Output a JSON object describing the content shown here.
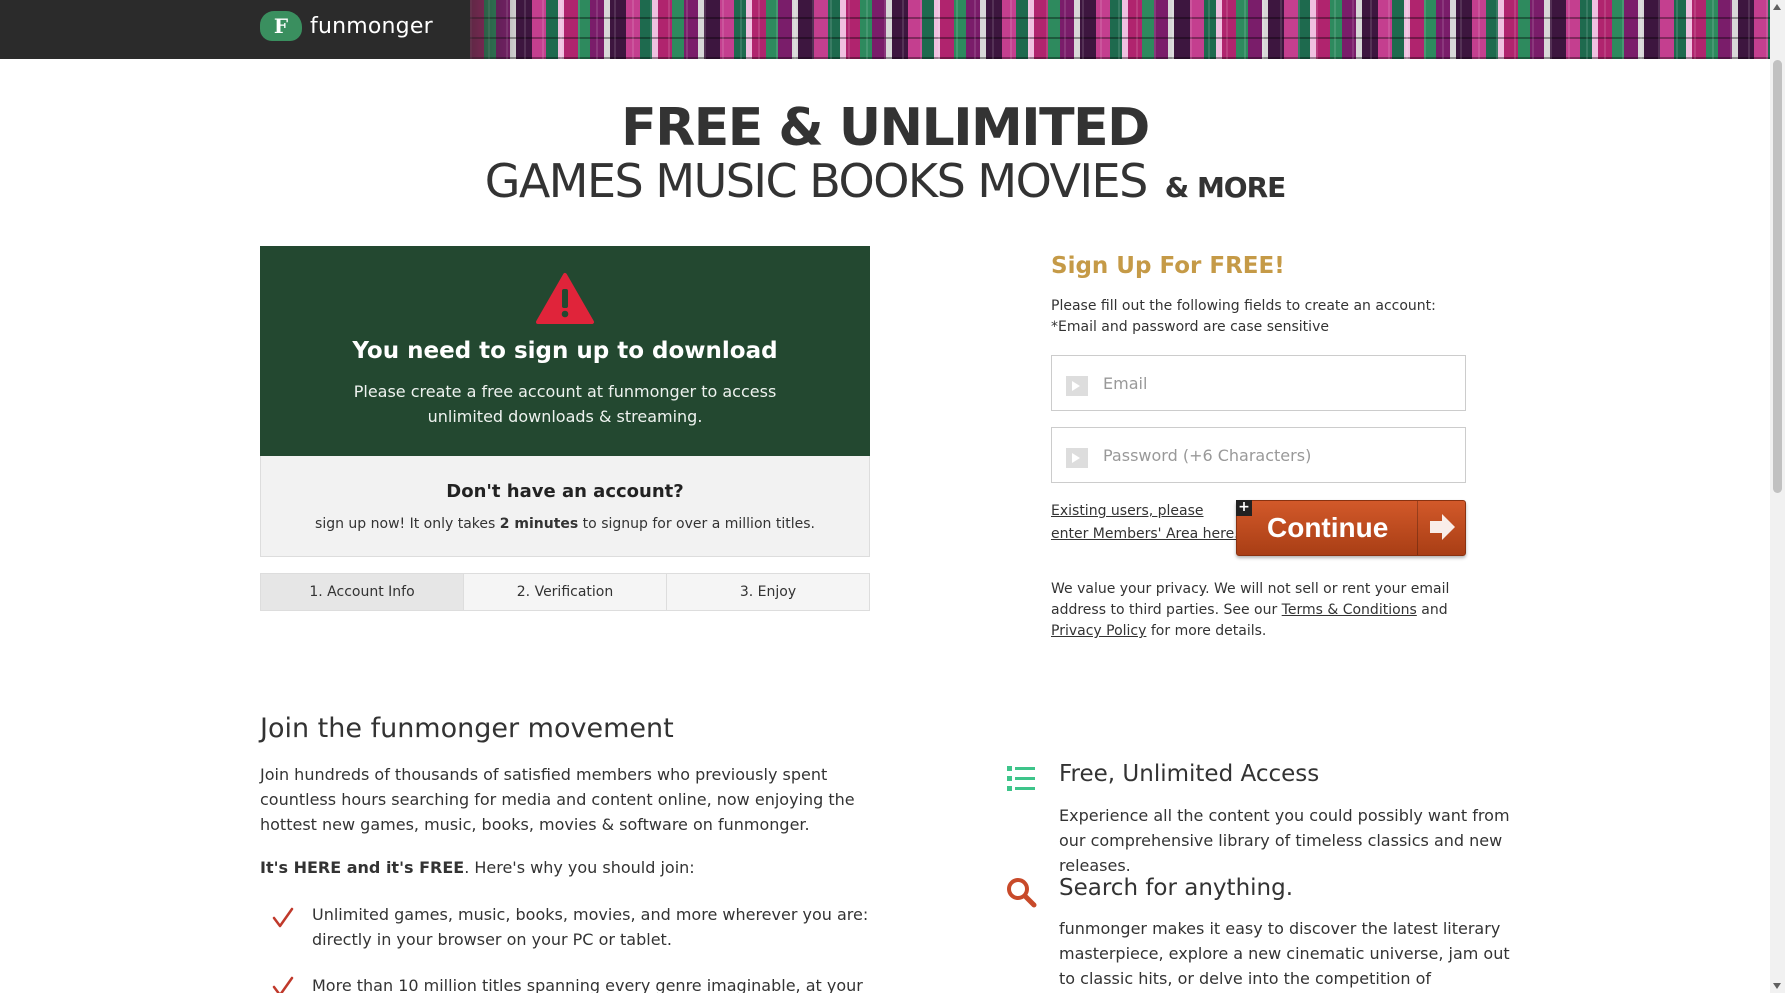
{
  "header": {
    "logo_letter": "F",
    "logo_text": "funmonger"
  },
  "hero": {
    "line1": "FREE & UNLIMITED",
    "line2": "GAMES MUSIC BOOKS MOVIES",
    "line2_more": "& MORE"
  },
  "notice": {
    "icon": "warning-icon",
    "title": "You need to sign up to download",
    "text": "Please create a free account at funmonger to access unlimited downloads & streaming."
  },
  "account": {
    "title": "Don't have an account?",
    "text_before": "sign up now! It only takes ",
    "text_bold": "2 minutes",
    "text_after": " to signup for over a million titles."
  },
  "steps": [
    "1. Account Info",
    "2. Verification",
    "3. Enjoy"
  ],
  "signup": {
    "title": "Sign Up For FREE!",
    "desc_line1": "Please fill out the following fields to create an account:",
    "desc_line2": "*Email and password are case sensitive",
    "email_placeholder": "Email",
    "password_placeholder": "Password (+6 Characters)",
    "members_link": "Existing users, please enter Members' Area here.",
    "plus_badge": "+",
    "continue_label": "Continue",
    "privacy_before": "We value your privacy. We will not sell or rent your email address to third parties. See our ",
    "terms_link": "Terms & Conditions",
    "privacy_mid": " and ",
    "privacy_link": "Privacy Policy",
    "privacy_after": " for more details."
  },
  "join": {
    "title": "Join the funmonger movement",
    "text": "Join hundreds of thousands of satisfied members who previously spent countless hours searching for media and content online, now enjoying the hottest new games, music, books, movies & software on funmonger.",
    "lead_bold": "It's HERE and it's FREE",
    "lead_rest": ". Here's why you should join:",
    "bullets": [
      "Unlimited games, music, books, movies, and more wherever you are: directly in your browser on your PC or tablet.",
      "More than 10 million titles spanning every genre imaginable, at your"
    ]
  },
  "features": [
    {
      "icon": "list-icon",
      "title": "Free, Unlimited Access",
      "text": "Experience all the content you could possibly want from our comprehensive library of timeless classics and new releases."
    },
    {
      "icon": "search-icon",
      "title": "Search for anything.",
      "text": "funmonger makes it easy to discover the latest literary masterpiece, explore a new cinematic universe, jam out to classic hits, or delve into the competition of multiplayer"
    }
  ],
  "colors": {
    "header_bg": "#2b2b2b",
    "logo_green": "#3a8f5f",
    "notice_bg": "#234830",
    "signup_title": "#c59a47",
    "continue_button": "#c44f21",
    "check_red": "#c0392b",
    "list_icon_green": "#3ec48a",
    "search_icon_red": "#c84a2a"
  }
}
